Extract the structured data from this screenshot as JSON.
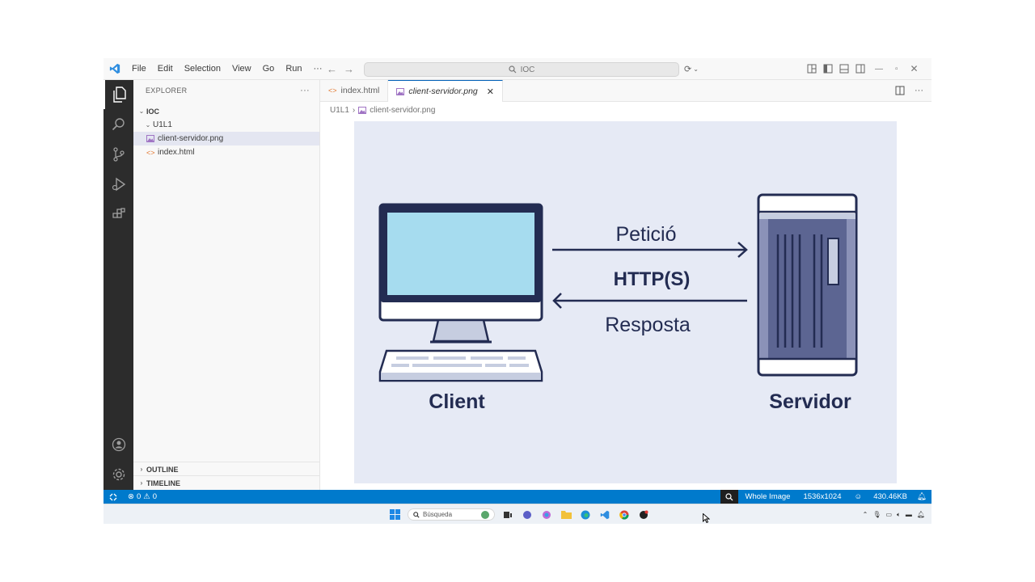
{
  "titlebar": {
    "menu": [
      "File",
      "Edit",
      "Selection",
      "View",
      "Go",
      "Run",
      "···"
    ],
    "search_text": "IOC"
  },
  "sidebar": {
    "title": "EXPLORER",
    "more": "···",
    "root_folder": "IOC",
    "subfolder": "U1L1",
    "files": [
      {
        "name": "client-servidor.png",
        "icon": "image-file-icon"
      },
      {
        "name": "index.html",
        "icon": "html-file-icon"
      }
    ],
    "outline_label": "OUTLINE",
    "timeline_label": "TIMELINE"
  },
  "editor": {
    "tabs": [
      {
        "label": "index.html",
        "icon": "html-file-icon",
        "active": false
      },
      {
        "label": "client-servidor.png",
        "icon": "image-file-icon",
        "active": true
      }
    ],
    "breadcrumb": [
      "U1L1",
      "client-servidor.png"
    ],
    "image": {
      "request_label": "Petició",
      "protocol_label": "HTTP(S)",
      "response_label": "Resposta",
      "client_label": "Client",
      "server_label": "Servidor",
      "colors": {
        "background": "#e6eaf5",
        "navy": "#232c52",
        "screen": "#a6dcef",
        "server_body": "#5c6592",
        "server_side": "#8b92b8",
        "stand": "#c6cde0"
      }
    }
  },
  "statusbar": {
    "errors": "0",
    "warnings": "0",
    "zoom_mode": "Whole Image",
    "dimensions": "1536x1024",
    "file_size": "430.46KB"
  },
  "taskbar": {
    "search_placeholder": "Búsqueda"
  }
}
